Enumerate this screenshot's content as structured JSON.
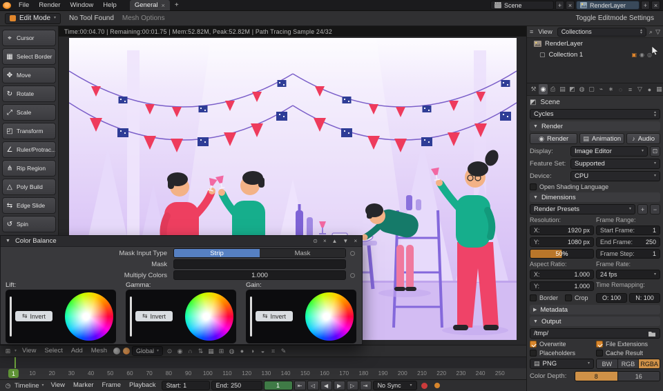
{
  "palette": {
    "accent": "#d8862c",
    "select_blue": "#5680c2",
    "frame_green": "#5f9336",
    "record_red": "#cc3b3b"
  },
  "glyphs": {
    "close": "×",
    "add": "+",
    "minus": "−",
    "dropdown": "▾",
    "dropdown_up": "▴",
    "section_open": "▼",
    "section_closed": "▶",
    "search": "⌕",
    "filter": "▽",
    "screen": "⊡",
    "clock": "◷",
    "grid": "⊞",
    "list": "≡",
    "scene": "◩",
    "camera": "◉",
    "film": "▤",
    "speaker": "♪",
    "invert": "⇆",
    "pin": "⊙",
    "arrow_up": "▲",
    "arrow_down": "▼",
    "box": "▢",
    "check_on": "▣",
    "eye": "◉",
    "restrict_render": "◎"
  },
  "topbar": {
    "menus": [
      {
        "label": "File"
      },
      {
        "label": "Render"
      },
      {
        "label": "Window"
      },
      {
        "label": "Help"
      }
    ],
    "workspace_tab": "General",
    "scene_field": {
      "label": "Scene"
    },
    "renderlayer_field": {
      "label": "RenderLayer"
    }
  },
  "modebar": {
    "mode": "Edit Mode",
    "tool_status": "No Tool Found",
    "mesh_options": "Mesh Options",
    "right_label": "Toggle Editmode Settings"
  },
  "tools": {
    "items": [
      {
        "label": "Cursor",
        "glyph": "⌖"
      },
      {
        "label": "Select Border",
        "glyph": "▦"
      },
      {
        "label": "Move",
        "glyph": "✥"
      },
      {
        "label": "Rotate",
        "glyph": "↻"
      },
      {
        "label": "Scale",
        "glyph": "⤢"
      },
      {
        "label": "Transform",
        "glyph": "◰"
      },
      {
        "label": "Ruler/Protrac...",
        "glyph": "∠"
      },
      {
        "label": "Rip Region",
        "glyph": "⋔"
      },
      {
        "label": "Poly Build",
        "glyph": "△"
      },
      {
        "label": "Edge Slide",
        "glyph": "⇆"
      },
      {
        "label": "Spin",
        "glyph": "↺"
      }
    ]
  },
  "viewport": {
    "render_status": "Time:00:04.70 | Remaining:00:01.75 | Mem:52.82M, Peak:52.82M | Path Tracing Sample 24/32"
  },
  "color_balance": {
    "title": "Color Balance",
    "mask_input_type_label": "Mask Input Type",
    "strip_option": "Strip",
    "mask_option": "Mask",
    "mask_label": "Mask",
    "multiply_label": "Multiply Colors",
    "multiply_value": "1.000",
    "wheels": [
      {
        "label": "Lift:",
        "invert": "Invert"
      },
      {
        "label": "Gamma:",
        "invert": "Invert"
      },
      {
        "label": "Gain:",
        "invert": "Invert"
      }
    ]
  },
  "outliner": {
    "view_menu": "View",
    "collections": "Collections",
    "renderlayer_item": "RenderLayer",
    "collection_item": "Collection 1"
  },
  "properties": {
    "tabs": [
      {
        "glyph": "⚒"
      },
      {
        "glyph": "◉"
      },
      {
        "glyph": "⎙"
      },
      {
        "glyph": "▤"
      },
      {
        "glyph": "◩"
      },
      {
        "glyph": "◍"
      },
      {
        "glyph": "▢"
      },
      {
        "glyph": "⌁"
      },
      {
        "glyph": "∗"
      },
      {
        "glyph": "◌"
      },
      {
        "glyph": "≡"
      },
      {
        "glyph": "▽"
      },
      {
        "glyph": "●"
      },
      {
        "glyph": "▦"
      }
    ],
    "context": "Scene",
    "engine": "Cycles",
    "render_section": "Render",
    "render_button": "Render",
    "animation_button": "Animation",
    "audio_button": "Audio",
    "display_label": "Display:",
    "display_value": "Image Editor",
    "feature_label": "Feature Set:",
    "feature_value": "Supported",
    "device_label": "Device:",
    "device_value": "CPU",
    "osl_label": "Open Shading Language",
    "dimensions_section": "Dimensions",
    "render_presets": "Render Presets",
    "resolution_label": "Resolution:",
    "frame_range_label": "Frame Range:",
    "res_x_label": "X:",
    "res_x_value": "1920 px",
    "res_y_label": "Y:",
    "res_y_value": "1080 px",
    "res_percent": "50%",
    "start_frame_label": "Start Frame:",
    "start_frame_value": "1",
    "end_frame_label": "End Frame:",
    "end_frame_value": "250",
    "frame_step_label": "Frame Step:",
    "frame_step_value": "1",
    "aspect_label": "Aspect Ratio:",
    "frame_rate_label": "Frame Rate:",
    "aspect_x_label": "X:",
    "aspect_x_value": "1.000",
    "aspect_y_label": "Y:",
    "aspect_y_value": "1.000",
    "frame_rate_value": "24 fps",
    "time_remap_label": "Time Remapping:",
    "remap_old": "O: 100",
    "remap_new": "N: 100",
    "border_label": "Border",
    "crop_label": "Crop",
    "metadata_section": "Metadata",
    "output_section": "Output",
    "output_path": "/tmp/",
    "overwrite_label": "Overwrite",
    "file_ext_label": "File Extensions",
    "placeholders_label": "Placeholders",
    "cache_label": "Cache Result",
    "format_value": "PNG",
    "channels": [
      {
        "label": "BW"
      },
      {
        "label": "RGB"
      },
      {
        "label": "RGBA"
      }
    ],
    "color_depth_label": "Color Depth:",
    "depths": [
      {
        "label": "8"
      },
      {
        "label": "16"
      }
    ]
  },
  "view3d": {
    "menus": [
      {
        "label": "View"
      },
      {
        "label": "Select"
      },
      {
        "label": "Add"
      },
      {
        "label": "Mesh"
      }
    ],
    "orientation": "Global",
    "icons": [
      {
        "glyph": "⊙"
      },
      {
        "glyph": "◉"
      },
      {
        "glyph": "∩"
      },
      {
        "glyph": "⇅"
      },
      {
        "glyph": "▦"
      },
      {
        "glyph": "⊞"
      },
      {
        "glyph": "◍"
      },
      {
        "glyph": "●"
      },
      {
        "glyph": "◑"
      },
      {
        "glyph": "◒"
      },
      {
        "glyph": "⌗"
      },
      {
        "glyph": "✎"
      }
    ]
  },
  "timeline": {
    "ticks": [
      {
        "v": "10"
      },
      {
        "v": "20"
      },
      {
        "v": "30"
      },
      {
        "v": "40"
      },
      {
        "v": "50"
      },
      {
        "v": "60"
      },
      {
        "v": "70"
      },
      {
        "v": "80"
      },
      {
        "v": "90"
      },
      {
        "v": "100"
      },
      {
        "v": "110"
      },
      {
        "v": "120"
      },
      {
        "v": "130"
      },
      {
        "v": "140"
      },
      {
        "v": "150"
      },
      {
        "v": "160"
      },
      {
        "v": "170"
      },
      {
        "v": "180"
      },
      {
        "v": "190"
      },
      {
        "v": "200"
      },
      {
        "v": "210"
      },
      {
        "v": "220"
      },
      {
        "v": "230"
      },
      {
        "v": "240"
      },
      {
        "v": "250"
      }
    ],
    "current_frame": "1",
    "editor": "Timeline",
    "menus": [
      {
        "label": "View"
      },
      {
        "label": "Marker"
      },
      {
        "label": "Frame"
      },
      {
        "label": "Playback"
      }
    ],
    "start_label": "Start:",
    "start_value": "1",
    "end_label": "End:",
    "end_value": "250",
    "frame_field": "1",
    "transport": [
      {
        "glyph": "⇤"
      },
      {
        "glyph": "◁"
      },
      {
        "glyph": "◀"
      },
      {
        "glyph": "▶"
      },
      {
        "glyph": "▷"
      },
      {
        "glyph": "⇥"
      }
    ],
    "sync": "No Sync"
  }
}
